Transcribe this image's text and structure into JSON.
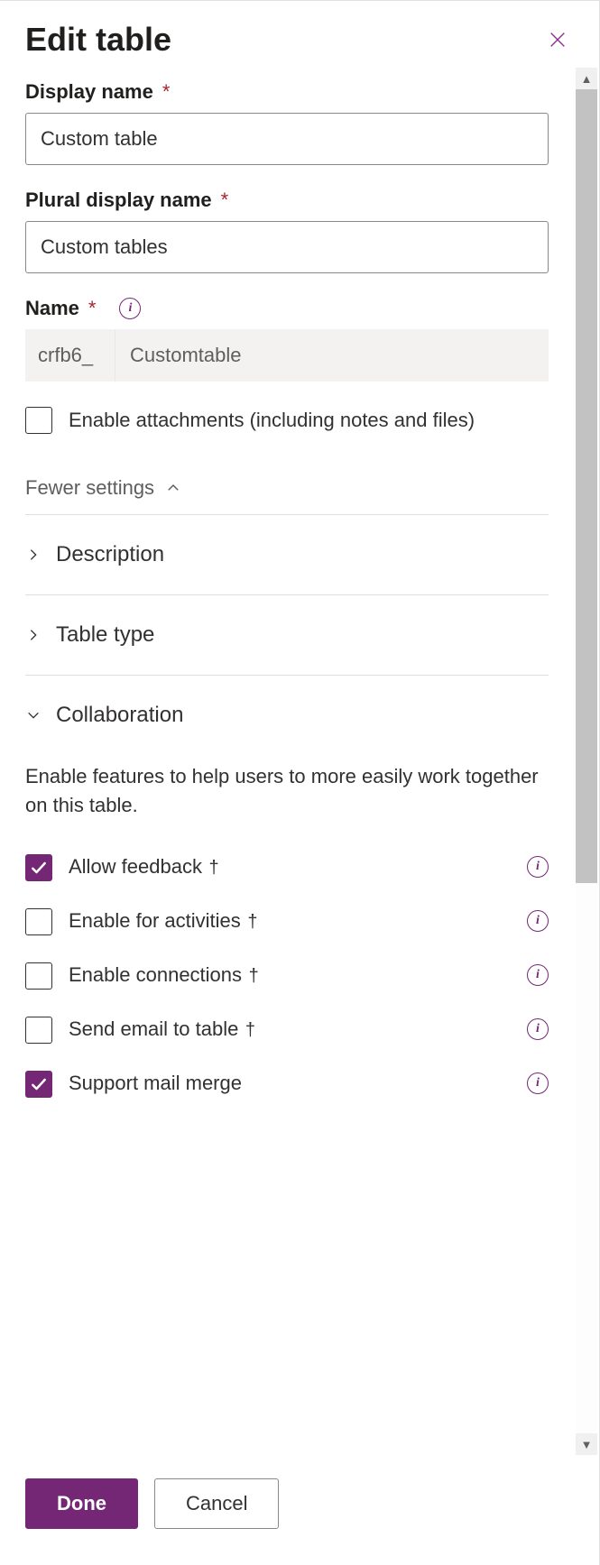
{
  "header": {
    "title": "Edit table"
  },
  "fields": {
    "display_name": {
      "label": "Display name",
      "value": "Custom table"
    },
    "plural_name": {
      "label": "Plural display name",
      "value": "Custom tables"
    },
    "name": {
      "label": "Name",
      "prefix": "crfb6_",
      "value": "Customtable"
    },
    "enable_attachments": {
      "label": "Enable attachments (including notes and files)",
      "checked": false
    }
  },
  "toggle": {
    "label": "Fewer settings"
  },
  "sections": {
    "description": {
      "title": "Description"
    },
    "table_type": {
      "title": "Table type"
    },
    "collaboration": {
      "title": "Collaboration",
      "desc": "Enable features to help users to more easily work together on this table.",
      "items": [
        {
          "label": "Allow feedback",
          "dagger": true,
          "checked": true,
          "info": true
        },
        {
          "label": "Enable for activities",
          "dagger": true,
          "checked": false,
          "info": true
        },
        {
          "label": "Enable connections",
          "dagger": true,
          "checked": false,
          "info": true
        },
        {
          "label": "Send email to table",
          "dagger": true,
          "checked": false,
          "info": true
        },
        {
          "label": "Support mail merge",
          "dagger": false,
          "checked": true,
          "info": true
        }
      ]
    }
  },
  "footer": {
    "done": "Done",
    "cancel": "Cancel"
  }
}
